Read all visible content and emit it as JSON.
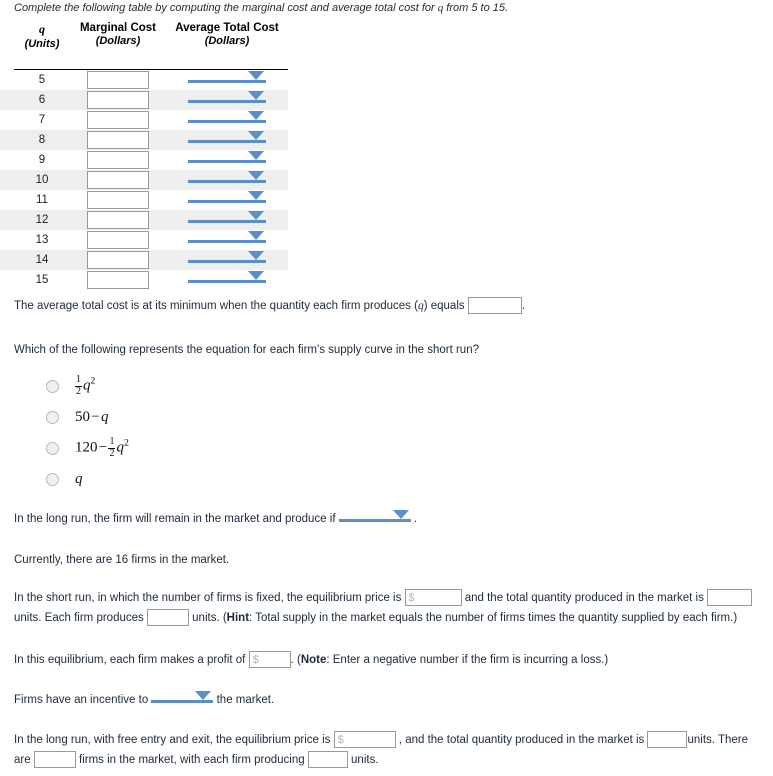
{
  "intro": {
    "text_before": "Complete the following table by computing the marginal cost and average total cost for ",
    "variable": "q",
    "text_after": " from 5 to 15."
  },
  "table": {
    "headers": [
      {
        "main": "q",
        "sub": "(Units)"
      },
      {
        "main": "Marginal Cost",
        "sub": "(Dollars)"
      },
      {
        "main": "Average Total Cost",
        "sub": "(Dollars)"
      }
    ],
    "rows": [
      {
        "q": "5",
        "marginal_cost": "",
        "average_total_cost": ""
      },
      {
        "q": "6",
        "marginal_cost": "",
        "average_total_cost": ""
      },
      {
        "q": "7",
        "marginal_cost": "",
        "average_total_cost": ""
      },
      {
        "q": "8",
        "marginal_cost": "",
        "average_total_cost": ""
      },
      {
        "q": "9",
        "marginal_cost": "",
        "average_total_cost": ""
      },
      {
        "q": "10",
        "marginal_cost": "",
        "average_total_cost": ""
      },
      {
        "q": "11",
        "marginal_cost": "",
        "average_total_cost": ""
      },
      {
        "q": "12",
        "marginal_cost": "",
        "average_total_cost": ""
      },
      {
        "q": "13",
        "marginal_cost": "",
        "average_total_cost": ""
      },
      {
        "q": "14",
        "marginal_cost": "",
        "average_total_cost": ""
      },
      {
        "q": "15",
        "marginal_cost": "",
        "average_total_cost": ""
      }
    ]
  },
  "min_atc": {
    "text_before": "The average total cost is at its minimum when the quantity each firm produces (",
    "variable": "q",
    "text_mid": ") equals ",
    "value": "",
    "text_after": "."
  },
  "supply_question": {
    "prompt": "Which of the following represents the equation for each firm's supply curve in the short run?",
    "options": [
      {
        "id": "opt-half-q-squared",
        "label": "1/2 q^2"
      },
      {
        "id": "opt-fifty-minus-q",
        "label": "50 − q"
      },
      {
        "id": "opt-120-minus-half-q-squared",
        "label": "120 − 1/2 q^2"
      },
      {
        "id": "opt-q",
        "label": "q"
      }
    ],
    "selected": null
  },
  "long_run_produce": {
    "text_before": "In the long run, the firm will remain in the market and produce if ",
    "dropdown_value": "",
    "text_after": " ."
  },
  "current_firms": {
    "text": "Currently, there are 16 firms in the market."
  },
  "short_run": {
    "text_1": "In the short run, in which the number of firms is fixed, the equilibrium price is ",
    "price_placeholder": "$",
    "price_value": "",
    "text_2": " and the total quantity produced in the market is ",
    "quantity_value": "",
    "text_3": "units. Each firm produces ",
    "per_firm_value": "",
    "text_4": " units. (",
    "hint_label": "Hint",
    "text_5": ": Total supply in the market equals the number of firms times the quantity supplied by each firm.)"
  },
  "profit": {
    "text_before": "In this equilibrium, each firm makes a profit of ",
    "placeholder": "$",
    "value": "",
    "text_mid": ". (",
    "note_label": "Note",
    "text_after": ": Enter a negative number if the firm is incurring a loss.)"
  },
  "incentive": {
    "text_before": "Firms have an incentive to ",
    "dropdown_value": "",
    "text_after": " the market."
  },
  "long_run_equilibrium": {
    "text_1": "In the long run, with free entry and exit, the equilibrium price is ",
    "price_placeholder": "$",
    "price_value": "",
    "text_2": " , and the total quantity produced in the market is ",
    "quantity_value": "",
    "text_3": "units. There",
    "text_4": "are ",
    "firms_value": "",
    "text_5": " firms in the market, with each firm producing ",
    "each_firm_value": "",
    "text_6": " units."
  },
  "colors": {
    "dropdown_blue": "#5b8fc9",
    "row_stripe": "#eeeeee",
    "input_border": "#9a9a9a",
    "text": "#1d2a3a"
  }
}
